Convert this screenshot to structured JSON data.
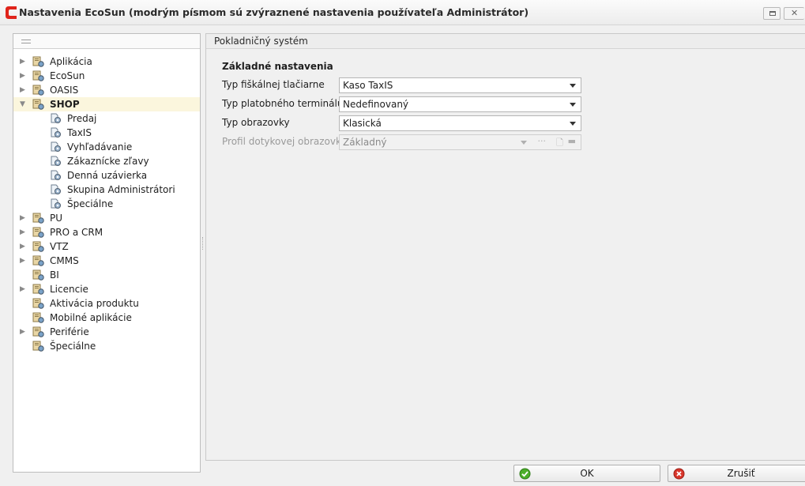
{
  "window": {
    "title": "Nastavenia EcoSun (modrým písmom sú zvýraznené nastavenia používateľa Administrátor)"
  },
  "tree": {
    "items": [
      {
        "label": "Aplikácia",
        "expandable": true
      },
      {
        "label": "EcoSun",
        "expandable": true
      },
      {
        "label": "OASIS",
        "expandable": true
      },
      {
        "label": "SHOP",
        "expandable": true,
        "expanded": true,
        "selected": true,
        "children": [
          {
            "label": "Predaj"
          },
          {
            "label": "TaxIS"
          },
          {
            "label": "Vyhľadávanie"
          },
          {
            "label": "Zákaznícke zľavy"
          },
          {
            "label": "Denná uzávierka"
          },
          {
            "label": "Skupina Administrátori"
          },
          {
            "label": "Špeciálne"
          }
        ]
      },
      {
        "label": "PU",
        "expandable": true
      },
      {
        "label": "PRO a CRM",
        "expandable": true
      },
      {
        "label": "VTZ",
        "expandable": true
      },
      {
        "label": "CMMS",
        "expandable": true
      },
      {
        "label": "BI",
        "expandable": false
      },
      {
        "label": "Licencie",
        "expandable": true
      },
      {
        "label": "Aktivácia produktu",
        "expandable": false
      },
      {
        "label": "Mobilné aplikácie",
        "expandable": false
      },
      {
        "label": "Periférie",
        "expandable": true
      },
      {
        "label": "Špeciálne",
        "expandable": false
      }
    ]
  },
  "panel": {
    "header": "Pokladničný systém",
    "section_title": "Základné nastavenia",
    "fields": [
      {
        "label": "Typ fiškálnej tlačiarne",
        "value": "Kaso TaxIS",
        "enabled": true
      },
      {
        "label": "Typ platobného terminálu",
        "value": "Nedefinovaný",
        "enabled": true
      },
      {
        "label": "Typ obrazovky",
        "value": "Klasická",
        "enabled": true
      },
      {
        "label": "Profil dotykovej obrazovky",
        "value": "Základný",
        "enabled": false
      }
    ]
  },
  "buttons": {
    "ok": "OK",
    "cancel": "Zrušiť"
  },
  "colors": {
    "selection": "#fbf6dd",
    "logo_red": "#e0241b",
    "ok_green": "#4caf2a",
    "cancel_red": "#d9362b"
  }
}
